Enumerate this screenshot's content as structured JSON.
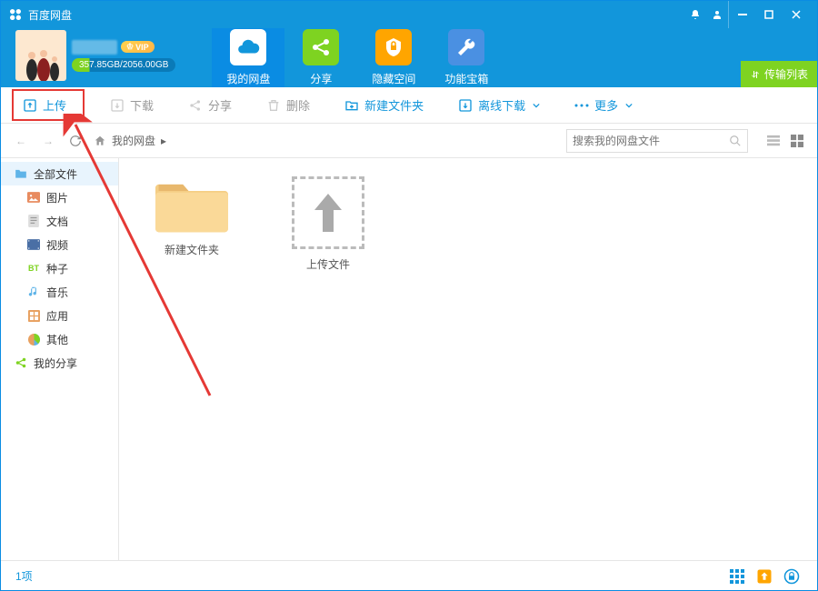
{
  "app": {
    "title": "百度网盘"
  },
  "user": {
    "vip_label": "VIP",
    "storage": "357.85GB/2056.00GB"
  },
  "nav": {
    "tabs": [
      {
        "label": "我的网盘",
        "icon": "cloud",
        "color": "#1296db"
      },
      {
        "label": "分享",
        "icon": "share",
        "color": "#7ed321"
      },
      {
        "label": "隐藏空间",
        "icon": "lock",
        "color": "#ffa500"
      },
      {
        "label": "功能宝箱",
        "icon": "wrench",
        "color": "#4a90e2"
      }
    ],
    "transfer": "传输列表"
  },
  "toolbar": {
    "upload": "上传",
    "download": "下载",
    "share": "分享",
    "delete": "删除",
    "new_folder": "新建文件夹",
    "offline": "离线下载",
    "more": "更多"
  },
  "breadcrumb": {
    "root": "我的网盘"
  },
  "search": {
    "placeholder": "搜索我的网盘文件"
  },
  "sidebar": {
    "items": [
      {
        "label": "全部文件",
        "icon": "folder-all"
      },
      {
        "label": "图片",
        "icon": "image"
      },
      {
        "label": "文档",
        "icon": "doc"
      },
      {
        "label": "视频",
        "icon": "video"
      },
      {
        "label": "种子",
        "icon": "bt"
      },
      {
        "label": "音乐",
        "icon": "music"
      },
      {
        "label": "应用",
        "icon": "app"
      },
      {
        "label": "其他",
        "icon": "other"
      }
    ],
    "my_share": "我的分享"
  },
  "files": {
    "folder_name": "新建文件夹",
    "upload_label": "上传文件"
  },
  "status": {
    "count": "1项"
  }
}
